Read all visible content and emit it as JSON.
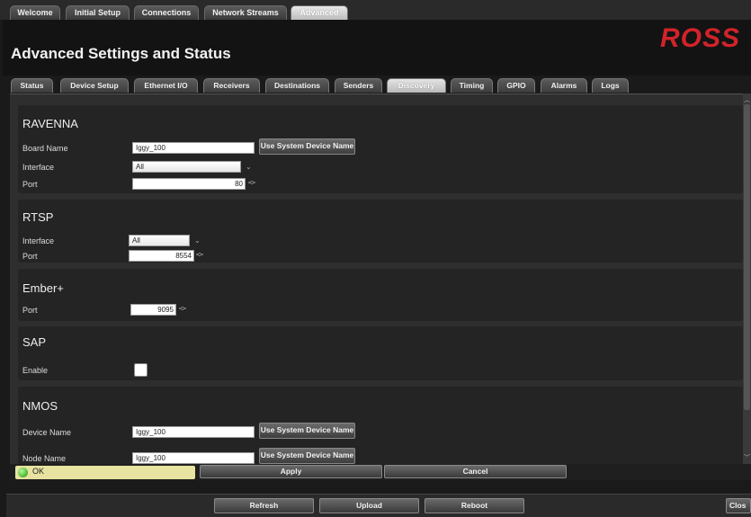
{
  "top_tabs": [
    "Welcome",
    "Initial Setup",
    "Connections",
    "Network Streams",
    "Advanced"
  ],
  "header": {
    "title": "Advanced Settings and Status",
    "logo": "ROSS"
  },
  "sub_tabs": [
    "Status",
    "Device Setup",
    "Ethernet I/O",
    "Receivers",
    "Destinations",
    "Senders",
    "Discovery",
    "Timing",
    "GPIO",
    "Alarms",
    "Logs"
  ],
  "ravenna": {
    "title": "RAVENNA",
    "board_name_label": "Board Name",
    "board_name_value": "Iggy_100",
    "use_system_name": "Use System Device Name",
    "interface_label": "Interface",
    "interface_value": "All",
    "port_label": "Port",
    "port_value": "80"
  },
  "rtsp": {
    "title": "RTSP",
    "interface_label": "Interface",
    "interface_value": "All",
    "port_label": "Port",
    "port_value": "8554"
  },
  "ember": {
    "title": "Ember+",
    "port_label": "Port",
    "port_value": "9095"
  },
  "sap": {
    "title": "SAP",
    "enable_label": "Enable"
  },
  "nmos": {
    "title": "NMOS",
    "device_name_label": "Device Name",
    "device_name_value": "Iggy_100",
    "node_name_label": "Node Name",
    "node_name_value": "Iggy_100",
    "use_system_name": "Use System Device Name"
  },
  "status": {
    "text": "OK",
    "apply": "Apply",
    "cancel": "Cancel"
  },
  "bottom": {
    "refresh": "Refresh",
    "upload": "Upload",
    "reboot": "Reboot",
    "close": "Clos"
  },
  "icons": {
    "status_led": "green-led-icon",
    "select_caret": "chevron-down-icon",
    "spinner": "spinner-arrows-icon"
  },
  "colors": {
    "logo": "#d2232a",
    "status_ok_bg": "#e8e3a0",
    "led": "#55c23a"
  }
}
